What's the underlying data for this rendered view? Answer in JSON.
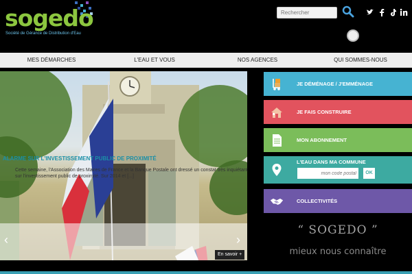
{
  "header": {
    "logo_word": "sogedo",
    "logo_subtitle": "Société de Gérance de Distribution d'Eau",
    "search_placeholder": "Rechercher",
    "social": [
      "twitter-icon",
      "facebook-icon",
      "tiktok-icon",
      "linkedin-icon"
    ]
  },
  "nav": {
    "items": [
      {
        "label": "Mes démarches"
      },
      {
        "label": "L'eau et vous"
      },
      {
        "label": "Nos agences"
      },
      {
        "label": "Qui sommes-nous"
      }
    ]
  },
  "slider": {
    "title": "Alarme sur l'investissement public de proximité",
    "text": "Cette semaine, l'Association des Maires de France et la Banque Postale ont dressé un constat très inquiétant sur l'investissement public de proximité. Sur 2014 et [...]",
    "more_label": "En savoir +"
  },
  "tiles": [
    {
      "label": "Je déménage / J'emménage",
      "color": "#46b3d2",
      "icon": "moving-trolley-icon"
    },
    {
      "label": "Je fais construire",
      "color": "#e2535e",
      "icon": "house-icon"
    },
    {
      "label": "Mon abonnement",
      "color": "#7bbd5a",
      "icon": "document-icon"
    },
    {
      "label": "L'eau dans ma commune",
      "color": "#3daaa1",
      "icon": "map-pin-icon"
    },
    {
      "label": "Collectivités",
      "color": "#6e58a8",
      "icon": "handshake-icon"
    }
  ],
  "commune": {
    "postcode_placeholder": "mon code postal",
    "ok_label": "OK"
  },
  "about": {
    "title": "“ SOGEDO ”",
    "subtitle": "mieux nous connaître"
  }
}
